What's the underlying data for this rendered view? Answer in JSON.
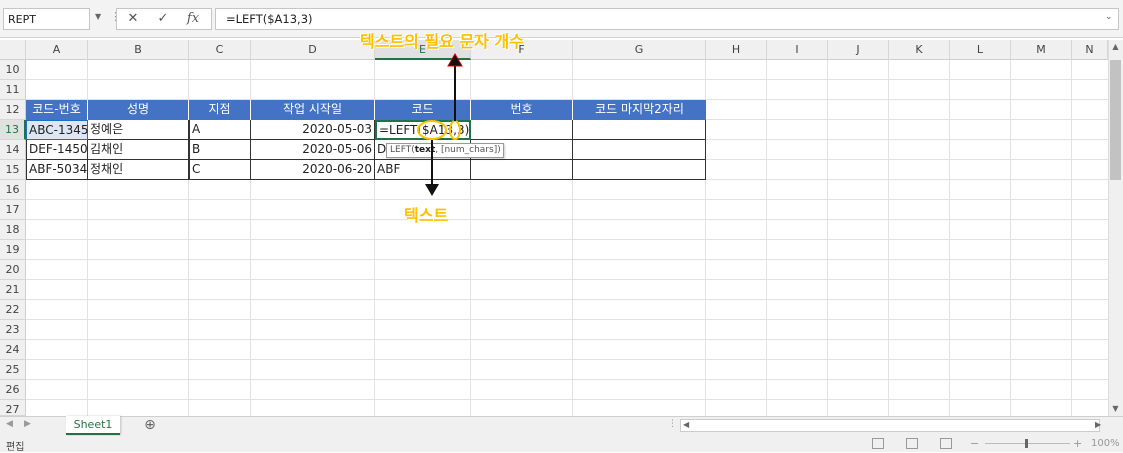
{
  "formula_bar": {
    "name_box": "REPT",
    "cancel_icon": "✕",
    "enter_icon": "✓",
    "fx_label": "fx",
    "formula": "=LEFT($A13,3)"
  },
  "columns": [
    "A",
    "B",
    "C",
    "D",
    "E",
    "F",
    "G",
    "H",
    "I",
    "J",
    "K",
    "L",
    "M",
    "N"
  ],
  "active_column": "E",
  "rows": [
    "10",
    "11",
    "12",
    "13",
    "14",
    "15",
    "16",
    "17",
    "18",
    "19",
    "20",
    "21",
    "22",
    "23",
    "24",
    "25",
    "26",
    "27"
  ],
  "active_row": "13",
  "table": {
    "headers": [
      "코드-번호",
      "성명",
      "지점",
      "작업 시작일",
      "코드",
      "번호",
      "코드 마지막2자리"
    ],
    "data": [
      [
        "ABC-1345",
        "정예은",
        "A",
        "2020-05-03",
        "=LEFT($A13,3)",
        "",
        ""
      ],
      [
        "DEF-1450",
        "김채인",
        "B",
        "2020-05-06",
        "D",
        "",
        ""
      ],
      [
        "ABF-5034",
        "정채인",
        "C",
        "2020-06-20",
        "ABF",
        "",
        ""
      ]
    ]
  },
  "tooltip": {
    "prefix": "LEFT(",
    "bold_arg": "text",
    "rest": ", [num_chars])"
  },
  "annotations": {
    "top": "텍스트의 필요 문자 개수",
    "bottom": "텍스트"
  },
  "accent_color": "#ffc000",
  "header_color": "#4472c4",
  "sheet_tabs": [
    "Sheet1"
  ],
  "add_sheet": "⊕",
  "status": {
    "mode": "편집",
    "zoom": "100%"
  }
}
